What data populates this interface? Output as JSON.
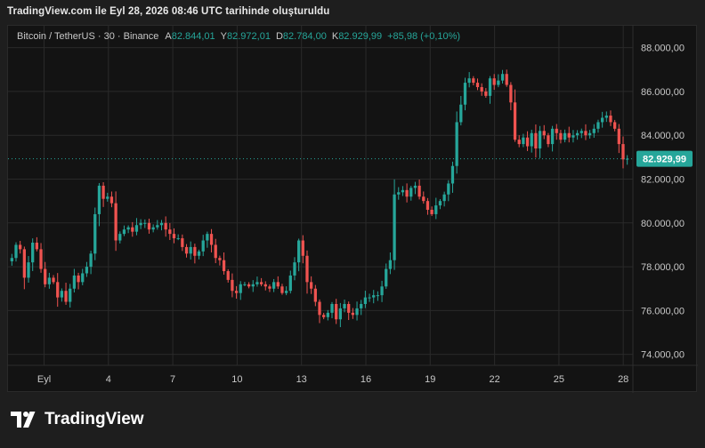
{
  "header": {
    "title": "TradingView.com ile Eyl 28, 2026 08:46 UTC tarihinde oluşturuldu"
  },
  "legend": {
    "symbol": "Bitcoin / TetherUS · 30 · Binance",
    "open_label": "A",
    "open": "82.844,01",
    "high_label": "Y",
    "high": "82.972,01",
    "low_label": "D",
    "low": "82.784,00",
    "close_label": "K",
    "close": "82.929,99",
    "change": "+85,98 (+0,10%)"
  },
  "branding": {
    "name": "TradingView"
  },
  "colors": {
    "up": "#26a69a",
    "down": "#ef5350",
    "background": "#131313",
    "grid": "#2a2a2a",
    "price_tag": "#26a69a"
  },
  "chart_data": {
    "type": "candlestick",
    "title": "Bitcoin / TetherUS · 30 · Binance",
    "xlabel": "",
    "ylabel": "",
    "ylim": [
      73500,
      89000
    ],
    "y_ticks": [
      "88.000,00",
      "86.000,00",
      "84.000,00",
      "82.000,00",
      "80.000,00",
      "78.000,00",
      "76.000,00",
      "74.000,00"
    ],
    "y_tick_values": [
      88000,
      86000,
      84000,
      82000,
      80000,
      78000,
      76000,
      74000
    ],
    "x_ticks": [
      "Eyl",
      "4",
      "7",
      "10",
      "13",
      "16",
      "19",
      "22",
      "25",
      "28"
    ],
    "last_price": 82929.99,
    "last_price_label": "82.929,99",
    "grid": true,
    "price_path_approx": [
      [
        0,
        78400
      ],
      [
        1,
        79000
      ],
      [
        2,
        78800
      ],
      [
        3,
        77500
      ],
      [
        4,
        78200
      ],
      [
        5,
        79100
      ],
      [
        6,
        78800
      ],
      [
        7,
        77900
      ],
      [
        8,
        77200
      ],
      [
        9,
        77500
      ],
      [
        10,
        77300
      ],
      [
        11,
        76600
      ],
      [
        12,
        76900
      ],
      [
        13,
        76400
      ],
      [
        14,
        77000
      ],
      [
        15,
        77600
      ],
      [
        16,
        77300
      ],
      [
        17,
        77700
      ],
      [
        18,
        78000
      ],
      [
        19,
        78600
      ],
      [
        20,
        80400
      ],
      [
        21,
        81700
      ],
      [
        22,
        81100
      ],
      [
        23,
        81200
      ],
      [
        24,
        80900
      ],
      [
        25,
        79200
      ],
      [
        26,
        79500
      ],
      [
        27,
        79700
      ],
      [
        28,
        79800
      ],
      [
        29,
        79600
      ],
      [
        30,
        79900
      ],
      [
        31,
        80000
      ],
      [
        32,
        80000
      ],
      [
        33,
        79700
      ],
      [
        34,
        79800
      ],
      [
        35,
        79900
      ],
      [
        36,
        80000
      ],
      [
        37,
        79700
      ],
      [
        38,
        79500
      ],
      [
        39,
        79300
      ],
      [
        40,
        79300
      ],
      [
        41,
        78900
      ],
      [
        42,
        78600
      ],
      [
        43,
        78900
      ],
      [
        44,
        78500
      ],
      [
        45,
        78700
      ],
      [
        46,
        79200
      ],
      [
        47,
        79500
      ],
      [
        48,
        79000
      ],
      [
        49,
        78400
      ],
      [
        50,
        78300
      ],
      [
        51,
        77800
      ],
      [
        52,
        77400
      ],
      [
        53,
        76900
      ],
      [
        54,
        76800
      ],
      [
        55,
        77200
      ],
      [
        56,
        77200
      ],
      [
        57,
        77100
      ],
      [
        58,
        77200
      ],
      [
        59,
        77300
      ],
      [
        60,
        77200
      ],
      [
        61,
        77100
      ],
      [
        62,
        77000
      ],
      [
        63,
        77300
      ],
      [
        64,
        77100
      ],
      [
        65,
        76800
      ],
      [
        66,
        76900
      ],
      [
        67,
        77600
      ],
      [
        68,
        78200
      ],
      [
        69,
        79200
      ],
      [
        70,
        78500
      ],
      [
        71,
        77300
      ],
      [
        72,
        77000
      ],
      [
        73,
        76400
      ],
      [
        74,
        75800
      ],
      [
        75,
        75700
      ],
      [
        76,
        75900
      ],
      [
        77,
        76300
      ],
      [
        78,
        75600
      ],
      [
        79,
        76100
      ],
      [
        80,
        76300
      ],
      [
        81,
        75900
      ],
      [
        82,
        75800
      ],
      [
        83,
        76100
      ],
      [
        84,
        76300
      ],
      [
        85,
        76600
      ],
      [
        86,
        76600
      ],
      [
        87,
        76700
      ],
      [
        88,
        76700
      ],
      [
        89,
        77100
      ],
      [
        90,
        77900
      ],
      [
        91,
        78300
      ],
      [
        92,
        81300
      ],
      [
        93,
        81400
      ],
      [
        94,
        81500
      ],
      [
        95,
        81200
      ],
      [
        96,
        81600
      ],
      [
        97,
        81700
      ],
      [
        98,
        81200
      ],
      [
        99,
        81000
      ],
      [
        100,
        80600
      ],
      [
        101,
        80400
      ],
      [
        102,
        80800
      ],
      [
        103,
        81000
      ],
      [
        104,
        81300
      ],
      [
        105,
        81800
      ],
      [
        106,
        82600
      ],
      [
        107,
        84600
      ],
      [
        108,
        85400
      ],
      [
        109,
        86400
      ],
      [
        110,
        86600
      ],
      [
        111,
        86400
      ],
      [
        112,
        86200
      ],
      [
        113,
        86000
      ],
      [
        114,
        85800
      ],
      [
        115,
        86600
      ],
      [
        116,
        86300
      ],
      [
        117,
        86500
      ],
      [
        118,
        86800
      ],
      [
        119,
        86300
      ],
      [
        120,
        85500
      ],
      [
        121,
        83800
      ],
      [
        122,
        83600
      ],
      [
        123,
        83900
      ],
      [
        124,
        83500
      ],
      [
        125,
        84100
      ],
      [
        126,
        83400
      ],
      [
        127,
        84200
      ],
      [
        128,
        84000
      ],
      [
        129,
        83600
      ],
      [
        130,
        84300
      ],
      [
        131,
        84100
      ],
      [
        132,
        83800
      ],
      [
        133,
        84100
      ],
      [
        134,
        83900
      ],
      [
        135,
        84000
      ],
      [
        136,
        84100
      ],
      [
        137,
        84200
      ],
      [
        138,
        84000
      ],
      [
        139,
        84100
      ],
      [
        140,
        84300
      ],
      [
        141,
        84600
      ],
      [
        142,
        84800
      ],
      [
        143,
        84900
      ],
      [
        144,
        84600
      ],
      [
        145,
        84300
      ],
      [
        146,
        83600
      ],
      [
        147,
        82900
      ],
      [
        148,
        82930
      ]
    ]
  }
}
